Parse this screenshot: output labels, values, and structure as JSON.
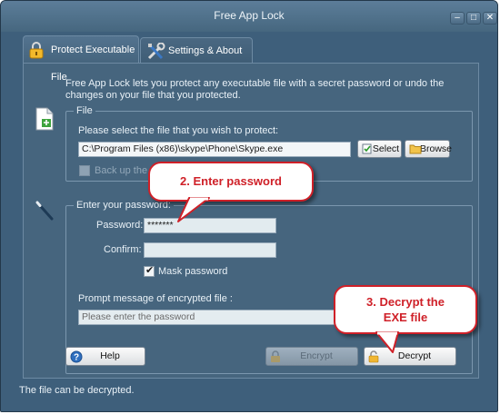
{
  "window": {
    "title": "Free App Lock"
  },
  "colors": {
    "accent": "#cf2028",
    "window_bg": "#3e5f7b"
  },
  "tabs": [
    {
      "label": "Protect Executable File",
      "icon": "padlock-icon",
      "active": true
    },
    {
      "label": "Settings & About",
      "icon": "tools-icon",
      "active": false
    }
  ],
  "intro_text": "Free App Lock lets you protect any executable file with a secret password or undo the changes on your file that you protected.",
  "file_group": {
    "label": "File",
    "prompt": "Please select the file that you wish to protect:",
    "path_value": "C:\\Program Files (x86)\\skype\\Phone\\Skype.exe",
    "select_label": "Select",
    "browse_label": "Browse",
    "backup_label": "Back up the cur",
    "backup_checked": false
  },
  "password_group": {
    "label": "Enter your password:",
    "password_label": "Password:",
    "password_value": "*******",
    "confirm_label": "Confirm:",
    "confirm_value": "",
    "mask_label": "Mask password",
    "mask_checked": true,
    "prompt_label": "Prompt message of encrypted file :",
    "prompt_placeholder": "Please enter the password"
  },
  "buttons": {
    "help": "Help",
    "encrypt": "Encrypt",
    "decrypt": "Decrypt"
  },
  "status": "The file can be decrypted.",
  "callouts": {
    "step2": "2. Enter password",
    "step3_line1": "3. Decrypt the",
    "step3_line2": "EXE file"
  }
}
